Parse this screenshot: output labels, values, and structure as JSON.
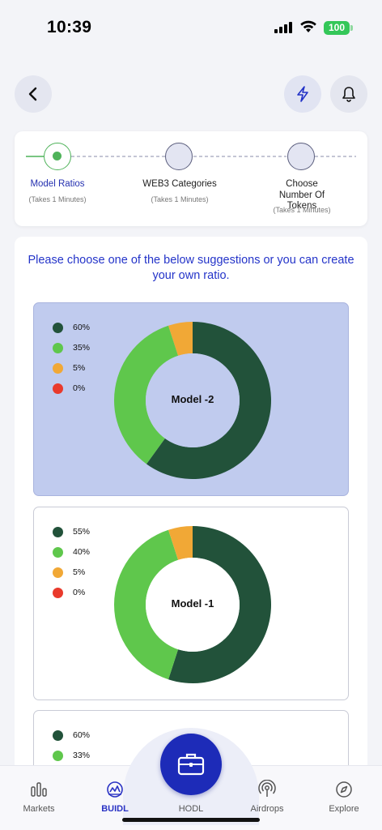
{
  "status": {
    "time": "10:39",
    "battery": "100"
  },
  "header": {
    "back_icon": "chevron-left-icon",
    "bolt_icon": "bolt-icon",
    "bell_icon": "bell-icon"
  },
  "stepper": {
    "steps": [
      {
        "label": "Model Ratios",
        "sub": "(Takes 1 Minutes)",
        "state": "active"
      },
      {
        "label": "WEB3 Categories",
        "sub": "(Takes 1 Minutes)",
        "state": "pending"
      },
      {
        "label": "Choose Number Of Tokens",
        "sub": "(Takes 1 Minutes)",
        "state": "pending"
      }
    ]
  },
  "prompt": "Please choose one of the below suggestions or you can create your own ratio.",
  "colors": {
    "dark_green": "#22523a",
    "green": "#5fc74c",
    "orange": "#f1a836",
    "red": "#e93a2c",
    "accent": "#1d2bb8",
    "selected_bg": "#c0cbee"
  },
  "models": [
    {
      "name": "Model -2",
      "selected": true,
      "legend": [
        "60%",
        "35%",
        "5%",
        "0%"
      ],
      "values": [
        60,
        35,
        5,
        0
      ]
    },
    {
      "name": "Model -1",
      "selected": false,
      "legend": [
        "55%",
        "40%",
        "5%",
        "0%"
      ],
      "values": [
        55,
        40,
        5,
        0
      ]
    },
    {
      "name": "",
      "selected": false,
      "legend": [
        "60%",
        "33%"
      ],
      "values": [
        60,
        33
      ]
    }
  ],
  "nav": {
    "items": [
      {
        "label": "Markets",
        "icon": "bar-chart-icon"
      },
      {
        "label": "BUIDL",
        "icon": "buidl-icon",
        "active": true
      },
      {
        "label": "HODL",
        "icon": "briefcase-icon"
      },
      {
        "label": "Airdrops",
        "icon": "airdrop-icon"
      },
      {
        "label": "Explore",
        "icon": "compass-icon"
      }
    ]
  }
}
